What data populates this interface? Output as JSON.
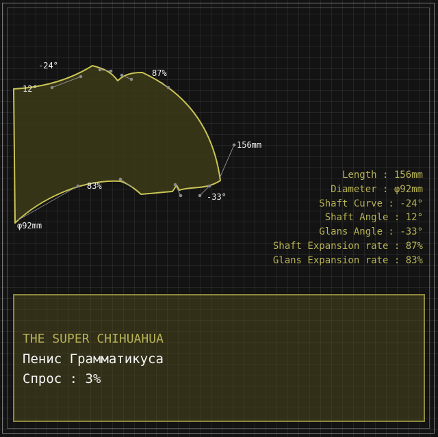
{
  "colors": {
    "background": "#131313",
    "accent": "#b7b255",
    "shape_stroke": "#c9c455",
    "shape_fill": "#3a3818",
    "text": "#f2f2f2",
    "leader": "#8a8a8a"
  },
  "annotations": {
    "shaft_curve": "-24°",
    "shaft_angle": "12°",
    "shaft_expansion": "87%",
    "length": "156mm",
    "glans_expansion": "83%",
    "glans_angle": "-33°",
    "diameter": "φ92mm"
  },
  "stats": [
    "Length : 156mm",
    "Diameter : φ92mm",
    "Shaft Curve : -24°",
    "Shaft Angle : 12°",
    "Glans Angle : -33°",
    "Shaft Expansion rate : 87%",
    "Glans Expansion rate : 83%"
  ],
  "card": {
    "title": "THE SUPER CHIHUAHUA",
    "name": "Пенис Грамматикуса",
    "demand": "Спрос : 3%"
  }
}
